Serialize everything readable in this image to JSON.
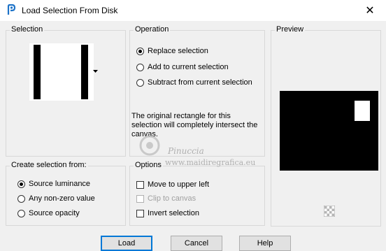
{
  "window": {
    "title": "Load Selection From Disk",
    "close_glyph": "✕"
  },
  "selection": {
    "group_title": "Selection"
  },
  "operation": {
    "group_title": "Operation",
    "options": [
      {
        "label": "Replace selection",
        "selected": true
      },
      {
        "label": "Add to current selection",
        "selected": false
      },
      {
        "label": "Subtract from current selection",
        "selected": false
      }
    ],
    "info_text": "The original rectangle for this selection will completely intersect the canvas."
  },
  "preview": {
    "group_title": "Preview"
  },
  "create_from": {
    "group_title": "Create selection from:",
    "options": [
      {
        "label": "Source luminance",
        "selected": true
      },
      {
        "label": "Any non-zero value",
        "selected": false
      },
      {
        "label": "Source opacity",
        "selected": false
      }
    ]
  },
  "options": {
    "group_title": "Options",
    "items": [
      {
        "label": "Move to upper left",
        "checked": false,
        "enabled": true
      },
      {
        "label": "Clip to canvas",
        "checked": false,
        "enabled": false
      },
      {
        "label": "Invert selection",
        "checked": false,
        "enabled": true
      }
    ]
  },
  "buttons": {
    "load": "Load",
    "cancel": "Cancel",
    "help": "Help"
  },
  "watermark": {
    "name": "Pinuccia",
    "site": "www.maidiregrafica.eu"
  },
  "icons": {
    "app": "app-logo-icon",
    "close": "close-icon",
    "dropdown": "dropdown-arrow-icon",
    "transparency": "checkerboard-icon"
  }
}
